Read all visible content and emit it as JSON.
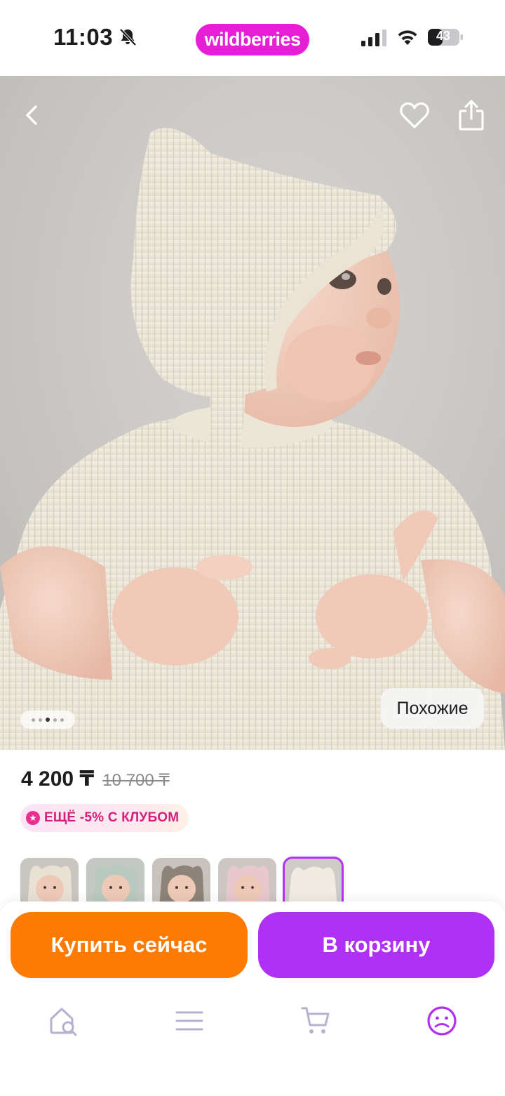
{
  "status_bar": {
    "time": "11:03",
    "brand": "wildberries",
    "battery": "43"
  },
  "product": {
    "price": "4 200 ₸",
    "old_price": "10 700 ₸",
    "club_badge": "ЕЩЁ -5% С КЛУБОМ",
    "similar_label": "Похожие",
    "gallery_dots": 5,
    "gallery_active_dot": 3,
    "thumbnails": [
      "thumb-1",
      "thumb-2",
      "thumb-3",
      "thumb-4",
      "thumb-5"
    ],
    "selected_thumbnail": 5
  },
  "actions": {
    "buy_now": "Купить сейчас",
    "add_to_cart": "В корзину"
  },
  "tabbar": {
    "items": [
      "home-search-icon",
      "catalog-menu-icon",
      "cart-icon",
      "profile-icon"
    ],
    "active": "profile-icon"
  },
  "colors": {
    "brand_pink": "#e61fd6",
    "accent_purple": "#b130f5",
    "buy_orange": "#ff7a00",
    "club_pink": "#d4207a",
    "tab_inactive": "#b5b2cf"
  }
}
